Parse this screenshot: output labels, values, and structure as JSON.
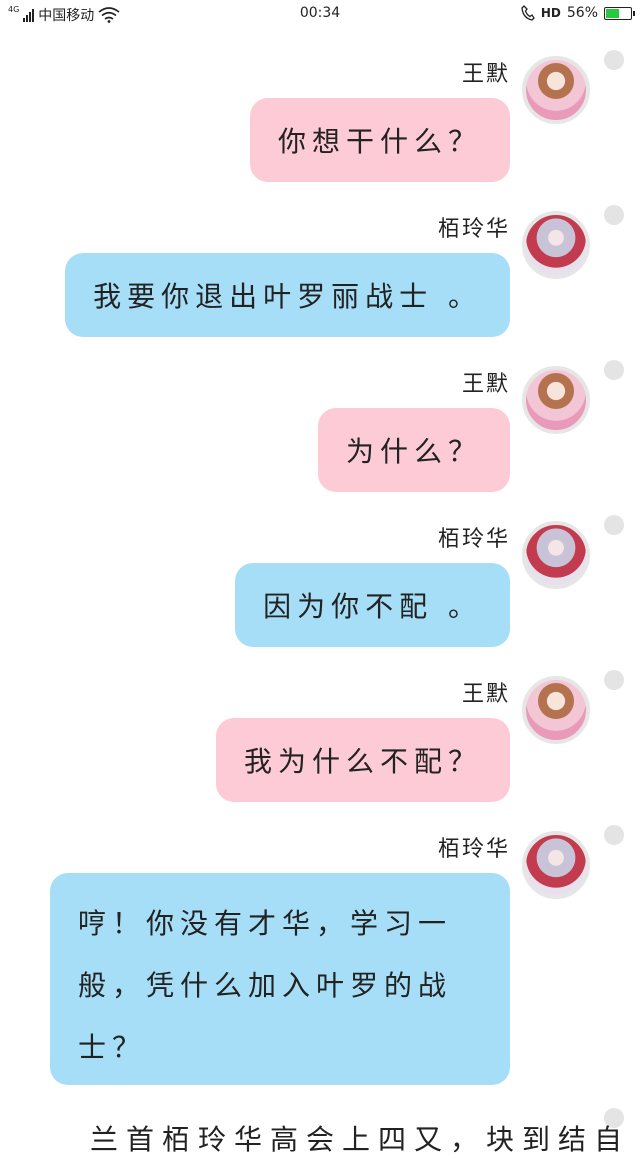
{
  "status_bar": {
    "network": "4G",
    "carrier": "中国移动",
    "time": "00:34",
    "hd_label": "HD",
    "battery_percent": "56%",
    "battery_level": 0.56,
    "wifi_icon": "wifi-icon",
    "battery_color": "#27c93f"
  },
  "colors": {
    "pink_bubble": "#fdcbd6",
    "blue_bubble": "#a6def7"
  },
  "messages": [
    {
      "sender": "王默",
      "text": "你想干什么？",
      "color": "pink"
    },
    {
      "sender": "栢玲华",
      "text": "我要你退出叶罗丽战士 。",
      "color": "blue"
    },
    {
      "sender": "王默",
      "text": "为什么？",
      "color": "pink"
    },
    {
      "sender": "栢玲华",
      "text": "因为你不配 。",
      "color": "blue"
    },
    {
      "sender": "王默",
      "text": "我为什么不配？",
      "color": "pink"
    },
    {
      "sender": "栢玲华",
      "text_lines": [
        "哼！你没有才华，学习一",
        "般，凭什么加入叶罗的战",
        "士？"
      ],
      "color": "blue"
    }
  ],
  "partial_text": "兰首栢玲华高会上四又，块到结自"
}
